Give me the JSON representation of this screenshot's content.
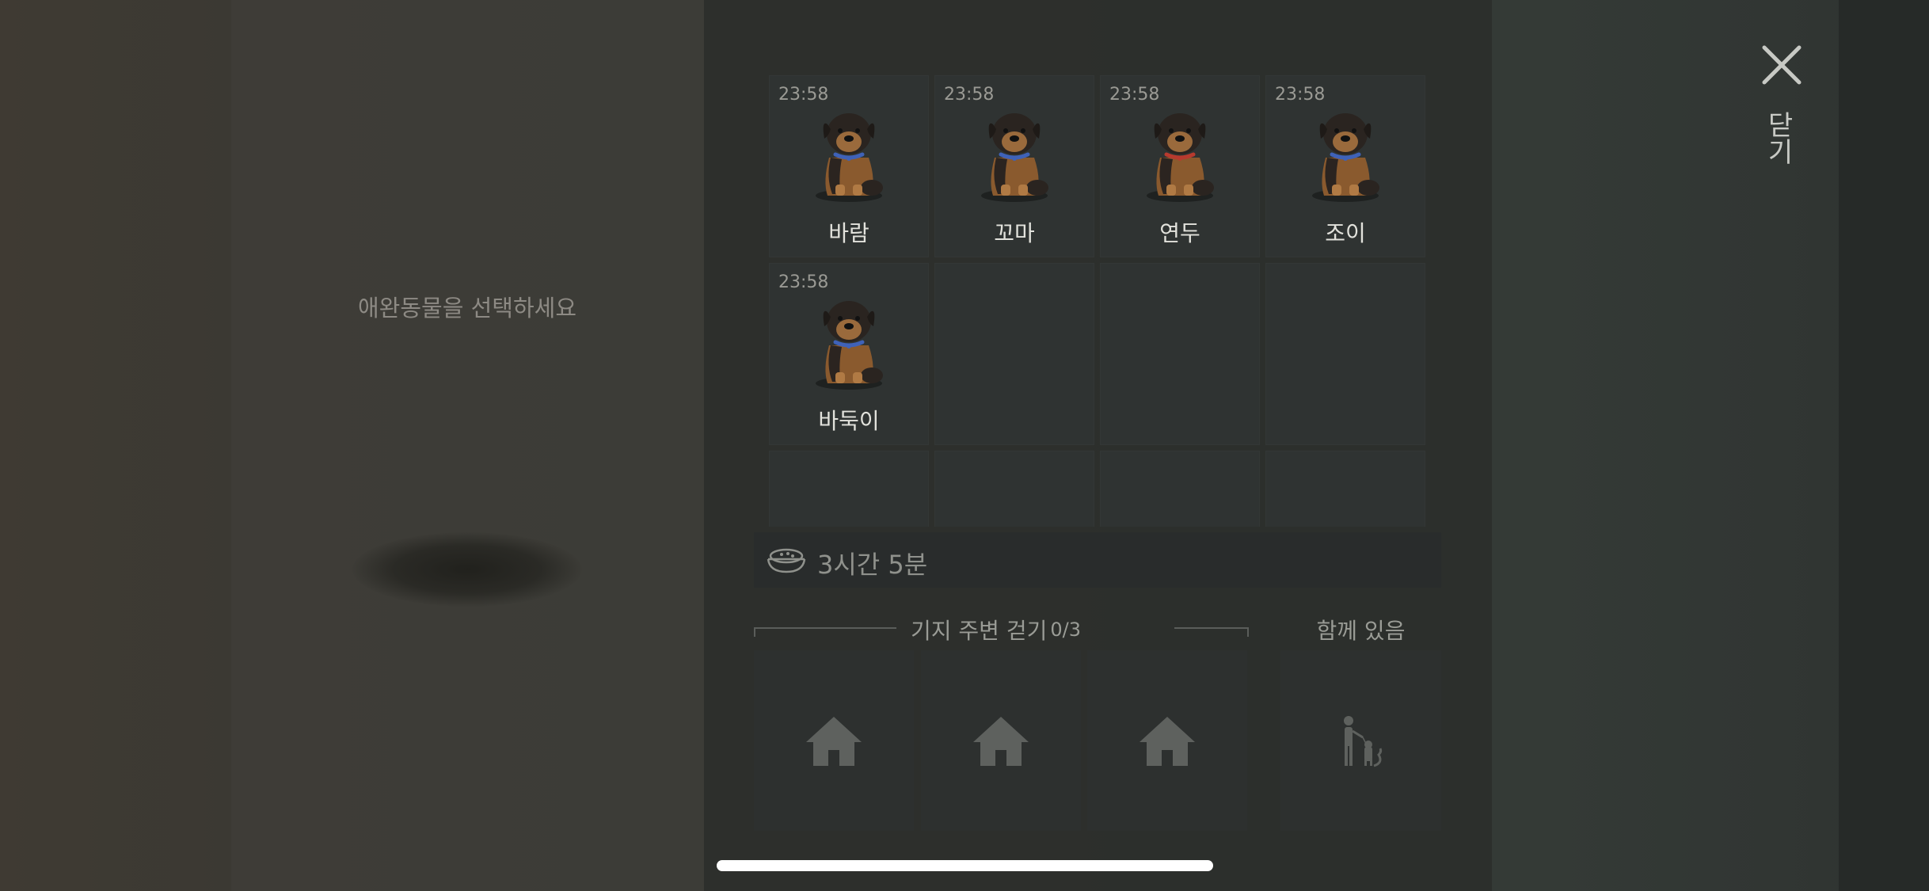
{
  "left_panel": {
    "prompt": "애완동물을 선택하세요"
  },
  "pets": [
    {
      "name": "바람",
      "timer": "23:58",
      "collar_color": "#3f62b8"
    },
    {
      "name": "꼬마",
      "timer": "23:58",
      "collar_color": "#3f62b8"
    },
    {
      "name": "연두",
      "timer": "23:58",
      "collar_color": "#b83a2e"
    },
    {
      "name": "조이",
      "timer": "23:58",
      "collar_color": "#3f62b8"
    },
    {
      "name": "바둑이",
      "timer": "23:58",
      "collar_color": "#3f62b8"
    }
  ],
  "food": {
    "icon": "food-bowl-icon",
    "time_remaining": "3시간 5분"
  },
  "walk": {
    "label": "기지 주변 걷기",
    "count": "0/3",
    "slot_icon": "house-icon"
  },
  "together": {
    "label": "함께 있음",
    "icon": "person-with-pets-icon"
  },
  "close": {
    "label": "닫기",
    "icon": "close-icon"
  },
  "colors": {
    "panel": "#2f3332",
    "text_primary": "#e2e2dc",
    "text_muted": "#9a9c96",
    "icon_gray": "#5e615e"
  }
}
